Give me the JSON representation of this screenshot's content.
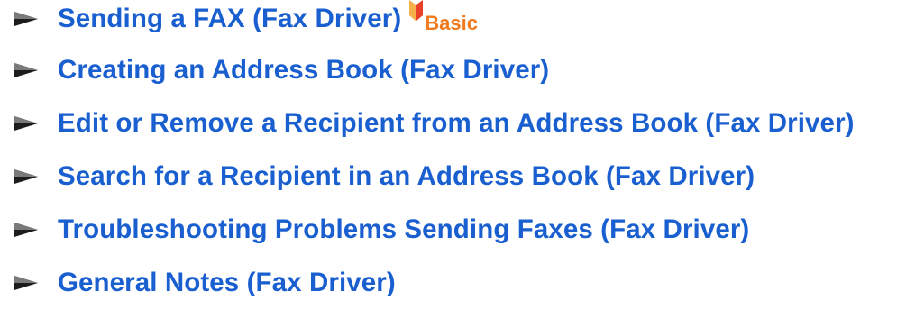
{
  "links": [
    {
      "label": "Sending a FAX (Fax Driver)",
      "badge": "Basic"
    },
    {
      "label": "Creating an Address Book (Fax Driver)"
    },
    {
      "label": "Edit or Remove a Recipient from an Address Book (Fax Driver)"
    },
    {
      "label": "Search for a Recipient in an Address Book (Fax Driver)"
    },
    {
      "label": "Troubleshooting Problems Sending Faxes (Fax Driver)"
    },
    {
      "label": "General Notes (Fax Driver)"
    }
  ],
  "icons": {
    "bullet": "triangle-arrow-icon",
    "badge": "basic-level-icon"
  },
  "colors": {
    "link": "#1a5fd0",
    "badge_text": "#f07a1c",
    "arrow_light": "#7a7a7a",
    "arrow_dark": "#1c1c1c",
    "badge_icon_left": "#f5b04a",
    "badge_icon_right": "#e8402a"
  }
}
